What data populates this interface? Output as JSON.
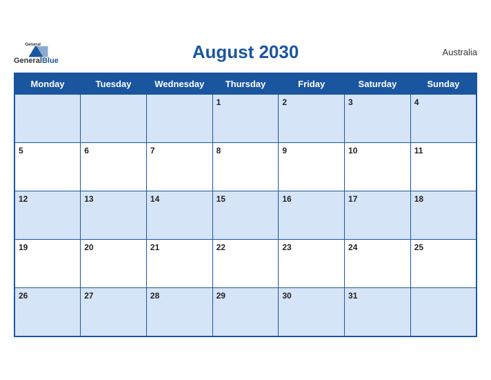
{
  "header": {
    "title": "August 2030",
    "country": "Australia",
    "logo": {
      "general": "General",
      "blue": "Blue"
    }
  },
  "weekdays": [
    "Monday",
    "Tuesday",
    "Wednesday",
    "Thursday",
    "Friday",
    "Saturday",
    "Sunday"
  ],
  "weeks": [
    [
      null,
      null,
      null,
      1,
      2,
      3,
      4
    ],
    [
      5,
      6,
      7,
      8,
      9,
      10,
      11
    ],
    [
      12,
      13,
      14,
      15,
      16,
      17,
      18
    ],
    [
      19,
      20,
      21,
      22,
      23,
      24,
      25
    ],
    [
      26,
      27,
      28,
      29,
      30,
      31,
      null
    ]
  ]
}
